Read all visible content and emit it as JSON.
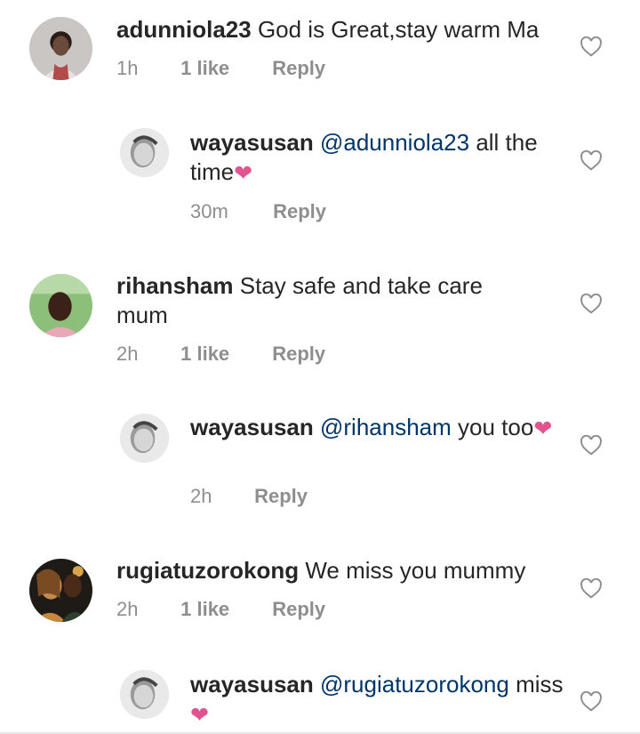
{
  "colors": {
    "text": "#262626",
    "meta": "#8e8e8e",
    "mention": "#003569",
    "heart": "#e0548f"
  },
  "comments": [
    {
      "user": "adunniola23",
      "mention": "",
      "text": "God is Great,stay warm Ma",
      "heart": "",
      "time": "1h",
      "likes": "1 like",
      "reply": "Reply"
    },
    {
      "user": "wayasusan",
      "mention": "@adunniola23",
      "text": "all the time",
      "heart": "❤",
      "time": "30m",
      "likes": "",
      "reply": "Reply"
    },
    {
      "user": "rihansham",
      "mention": "",
      "text": "Stay safe and take care mum",
      "heart": "",
      "time": "2h",
      "likes": "1 like",
      "reply": "Reply"
    },
    {
      "user": "wayasusan",
      "mention": "@rihansham",
      "text": "you too",
      "heart": "❤",
      "time": "2h",
      "likes": "",
      "reply": "Reply"
    },
    {
      "user": "rugiatuzorokong",
      "mention": "",
      "text": "We miss you mummy",
      "heart": "",
      "time": "2h",
      "likes": "1 like",
      "reply": "Reply"
    },
    {
      "user": "wayasusan",
      "mention": "@rugiatuzorokong",
      "text": "miss",
      "heart": "❤",
      "time": "",
      "likes": "",
      "reply": ""
    }
  ]
}
